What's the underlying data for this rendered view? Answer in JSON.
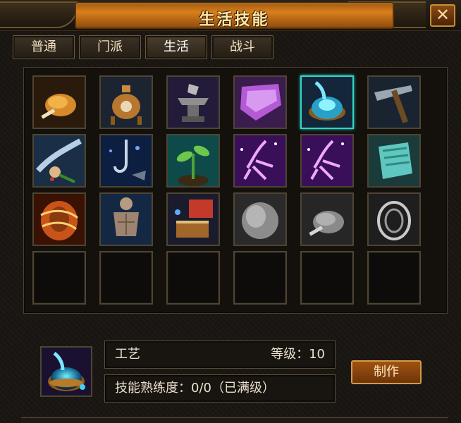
{
  "window": {
    "title": "生活技能",
    "close_label": "✕"
  },
  "tabs": [
    {
      "label": "普通",
      "active": false
    },
    {
      "label": "门派",
      "active": false
    },
    {
      "label": "生活",
      "active": true
    },
    {
      "label": "战斗",
      "active": false
    }
  ],
  "skills": [
    {
      "icon": "roast-chicken-icon",
      "empty": false
    },
    {
      "icon": "alchemy-furnace-icon",
      "empty": false
    },
    {
      "icon": "anvil-icon",
      "empty": false
    },
    {
      "icon": "tailoring-robe-icon",
      "empty": false
    },
    {
      "icon": "crafting-orb-icon",
      "empty": false,
      "selected": true
    },
    {
      "icon": "mining-pickaxe-icon",
      "empty": false
    },
    {
      "icon": "herb-picking-icon",
      "empty": false
    },
    {
      "icon": "fishing-hook-icon",
      "empty": false
    },
    {
      "icon": "sprout-icon",
      "empty": false
    },
    {
      "icon": "purple-dance-icon",
      "empty": false
    },
    {
      "icon": "purple-dance-icon",
      "empty": false
    },
    {
      "icon": "scroll-icon",
      "empty": false
    },
    {
      "icon": "fire-whirl-icon",
      "empty": false
    },
    {
      "icon": "muscle-body-icon",
      "empty": false
    },
    {
      "icon": "book-crafting-icon",
      "empty": false
    },
    {
      "icon": "gray-stone-icon",
      "empty": false,
      "disabled": true
    },
    {
      "icon": "gray-chicken-icon",
      "empty": false,
      "disabled": true
    },
    {
      "icon": "gray-whirl-icon",
      "empty": false,
      "disabled": true
    },
    {
      "icon": "empty-slot",
      "empty": true
    },
    {
      "icon": "empty-slot",
      "empty": true
    },
    {
      "icon": "empty-slot",
      "empty": true
    },
    {
      "icon": "empty-slot",
      "empty": true
    },
    {
      "icon": "empty-slot",
      "empty": true
    },
    {
      "icon": "empty-slot",
      "empty": true
    }
  ],
  "detail": {
    "icon": "crafting-orb-icon",
    "name": "工艺",
    "level_text": "等级：10",
    "proficiency_text": "技能熟练度：0/0（已满级）",
    "make_button_label": "制作"
  },
  "colors": {
    "accent_orange": "#d97f1c",
    "selected_border": "#2fd6c9",
    "text_light": "#e9e0cf"
  }
}
